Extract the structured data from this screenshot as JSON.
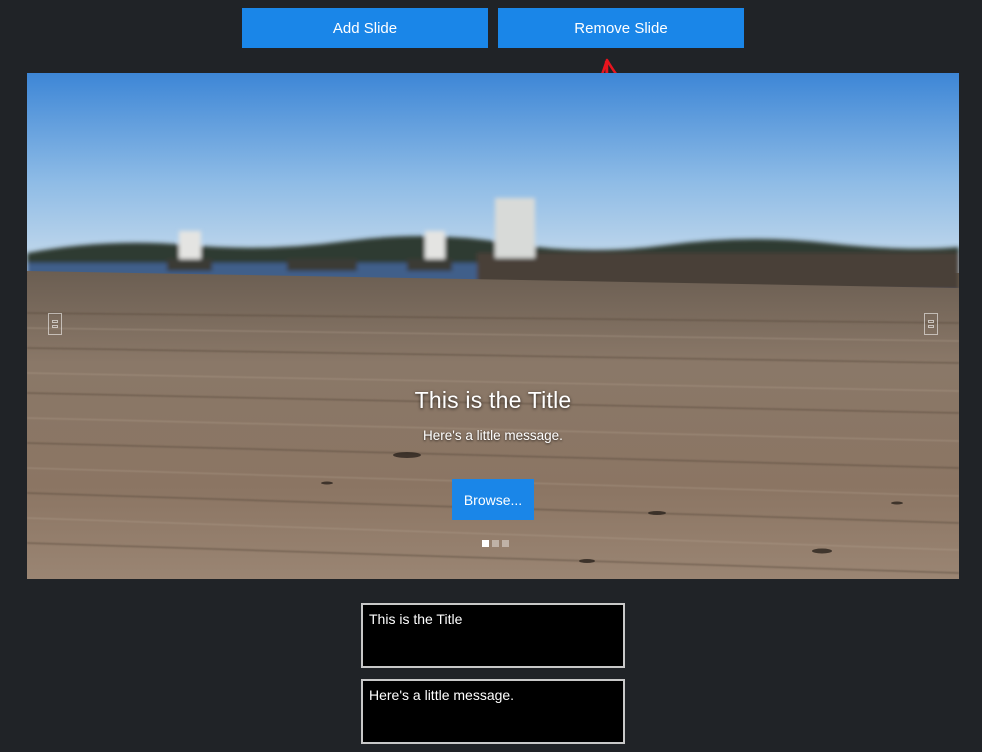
{
  "toolbar": {
    "add_label": "Add Slide",
    "remove_label": "Remove Slide"
  },
  "slide": {
    "title": "This is the Title",
    "message": "Here's a little message.",
    "button_label": "Browse...",
    "indicator_count": 3,
    "active_indicator": 1
  },
  "editor": {
    "title_value": "This is the Title",
    "message_value": "Here's a little message."
  },
  "icons": {
    "prev": "chevron-left-icon",
    "next": "chevron-right-icon",
    "annotation": "red-arrow-annotation"
  },
  "colors": {
    "page_bg": "#202327",
    "accent": "#1a86e8",
    "annotation": "#e8141e"
  }
}
